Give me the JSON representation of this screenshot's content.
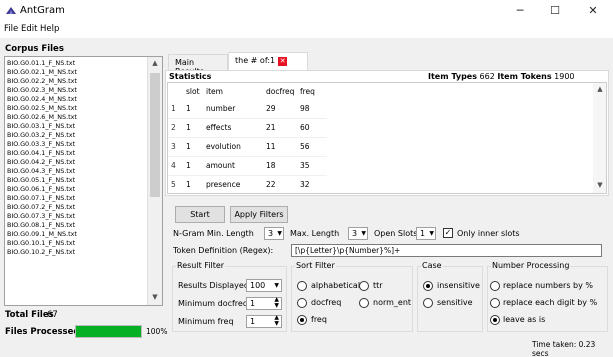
{
  "app": {
    "title": "AntGram",
    "minimize": "─",
    "maximize": "☐",
    "close": "✕"
  },
  "menu": [
    "File",
    "Edit",
    "Help"
  ],
  "corpus": {
    "title": "Corpus Files",
    "files": [
      "BIO.G0.01.1_F_NS.txt",
      "BIO.G0.02.1_M_NS.txt",
      "BIO.G0.02.2_M_NS.txt",
      "BIO.G0.02.3_M_NS.txt",
      "BIO.G0.02.4_M_NS.txt",
      "BIO.G0.02.5_M_NS.txt",
      "BIO.G0.02.6_M_NS.txt",
      "BIO.G0.03.1_F_NS.txt",
      "BIO.G0.03.2_F_NS.txt",
      "BIO.G0.03.3_F_NS.txt",
      "BIO.G0.04.1_F_NS.txt",
      "BIO.G0.04.2_F_NS.txt",
      "BIO.G0.04.3_F_NS.txt",
      "BIO.G0.05.1_F_NS.txt",
      "BIO.G0.06.1_F_NS.txt",
      "BIO.G0.07.1_F_NS.txt",
      "BIO.G0.07.2_F_NS.txt",
      "BIO.G0.07.3_F_NS.txt",
      "BIO.G0.08.1_F_NS.txt",
      "BIO.G0.09.1_M_NS.txt",
      "BIO.G0.10.1_F_NS.txt",
      "BIO.G0.10.2_F_NS.txt"
    ],
    "total_files_label": "Total Files",
    "total_files_value": "67",
    "files_processed_label": "Files Processed",
    "progress": 1.0,
    "progress_text": "100%"
  },
  "tabs": [
    {
      "label": "Main Results"
    },
    {
      "label": "the # of:1",
      "close": "✕"
    }
  ],
  "stats": {
    "statistics_label": "Statistics",
    "item_types_label": "Item Types",
    "item_types_value": "662",
    "item_tokens_label": "Item Tokens",
    "item_tokens_value": "1900"
  },
  "table": {
    "headers": [
      "",
      "slot",
      "item",
      "docfreq",
      "freq"
    ],
    "rows": [
      [
        "1",
        "1",
        "number",
        "29",
        "98"
      ],
      [
        "2",
        "1",
        "effects",
        "21",
        "60"
      ],
      [
        "3",
        "1",
        "evolution",
        "11",
        "56"
      ],
      [
        "4",
        "1",
        "amount",
        "18",
        "35"
      ],
      [
        "5",
        "1",
        "presence",
        "22",
        "32"
      ]
    ]
  },
  "controls": {
    "start": "Start",
    "apply_filters": "Apply Filters",
    "ngram_min_label": "N-Gram Min. Length",
    "ngram_min_value": "3",
    "max_length_label": "Max. Length",
    "max_length_value": "3",
    "open_slots_label": "Open Slots",
    "open_slots_value": "1",
    "only_inner_slots_label": "Only inner slots",
    "only_inner_slots_checked": true,
    "token_def_label": "Token Definition (Regex):",
    "token_def_value": "[\\p{Letter}\\p{Number}%]+"
  },
  "result_filter": {
    "title": "Result Filter",
    "results_displayed_label": "Results Displayed",
    "results_displayed_value": "100",
    "min_docfreq_label": "Minimum docfreq",
    "min_docfreq_value": "1",
    "min_freq_label": "Minimum freq",
    "min_freq_value": "1"
  },
  "sort_filter": {
    "title": "Sort Filter",
    "options": [
      "alphabetical",
      "ttr",
      "docfreq",
      "norm_ent",
      "freq"
    ],
    "selected": "freq"
  },
  "case": {
    "title": "Case",
    "options": [
      "insensitive",
      "sensitive"
    ],
    "selected": "insensitive"
  },
  "number_processing": {
    "title": "Number Processing",
    "options": [
      "replace numbers by %",
      "replace each digit by %",
      "leave as is"
    ],
    "selected": "leave as is"
  },
  "status": {
    "time_taken": "Time taken: 0.23 secs"
  },
  "colors": {
    "progress": "#06b025",
    "tab_close": "#e81123"
  },
  "icons": {
    "app": "ant-icon",
    "dropdown": "chevron-down-icon",
    "spinner": "spinner-arrows-icon"
  }
}
